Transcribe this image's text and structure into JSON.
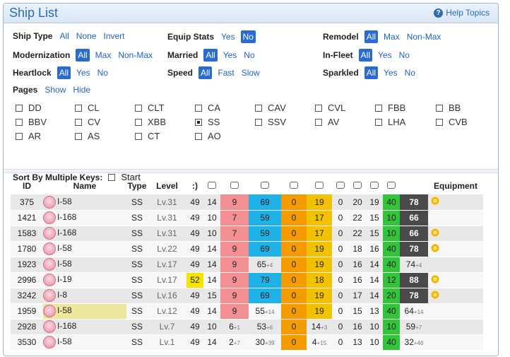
{
  "header": {
    "title": "Ship List",
    "help": "Help Topics"
  },
  "filters": {
    "ship_type": {
      "label": "Ship Type",
      "options": [
        "All",
        "None",
        "Invert"
      ]
    },
    "equip_stats": {
      "label": "Equip Stats",
      "options": [
        "Yes",
        "No"
      ]
    },
    "remodel": {
      "label": "Remodel",
      "options": [
        "All",
        "Max",
        "Non-Max"
      ]
    },
    "modernization": {
      "label": "Modernization",
      "options": [
        "All",
        "Max",
        "Non-Max"
      ]
    },
    "married": {
      "label": "Married",
      "options": [
        "All",
        "Yes",
        "No"
      ]
    },
    "in_fleet": {
      "label": "In-Fleet",
      "options": [
        "All",
        "Yes",
        "No"
      ]
    },
    "heartlock": {
      "label": "Heartlock",
      "options": [
        "All",
        "Yes",
        "No"
      ]
    },
    "speed": {
      "label": "Speed",
      "options": [
        "All",
        "Fast",
        "Slow"
      ]
    },
    "sparkled": {
      "label": "Sparkled",
      "options": [
        "All",
        "Yes",
        "No"
      ]
    },
    "pages": {
      "label": "Pages",
      "options": [
        "Show",
        "Hide"
      ]
    }
  },
  "types": [
    "DD",
    "CL",
    "CLT",
    "CA",
    "CAV",
    "CVL",
    "FBB",
    "BB",
    "BBV",
    "CV",
    "XBB",
    "SS",
    "SSV",
    "AV",
    "LHA",
    "CVB",
    "AR",
    "AS",
    "CT",
    "AO"
  ],
  "sort": {
    "label": "Sort By Multiple Keys:",
    "start": "Start"
  },
  "table": {
    "headers": [
      "ID",
      "Name",
      "Type",
      "Level",
      ":)",
      "HP",
      "FP",
      "TP",
      "AA",
      "AR",
      "ASW",
      "EV",
      "LOS",
      "Luck",
      "Equipment"
    ],
    "rows": [
      {
        "id": "375",
        "name": "I-58",
        "type": "SS",
        "lv": "Lv.31",
        "mor": "49",
        "hp": "14",
        "fp": "9",
        "tp": "69",
        "aa": "0",
        "ar": "19",
        "asw": "0",
        "ev": "20",
        "los": "19",
        "luck": "40",
        "eq": "78",
        "gear": true
      },
      {
        "id": "1421",
        "name": "I-168",
        "type": "SS",
        "lv": "Lv.31",
        "mor": "49",
        "hp": "10",
        "fp": "7",
        "tp": "59",
        "aa": "0",
        "ar": "17",
        "asw": "0",
        "ev": "22",
        "los": "15",
        "luck": "10",
        "eq": "66",
        "gear": false
      },
      {
        "id": "1583",
        "name": "I-168",
        "type": "SS",
        "lv": "Lv.31",
        "mor": "49",
        "hp": "10",
        "fp": "7",
        "tp": "59",
        "aa": "0",
        "ar": "17",
        "asw": "0",
        "ev": "22",
        "los": "15",
        "luck": "10",
        "eq": "66",
        "gear": true
      },
      {
        "id": "1780",
        "name": "I-58",
        "type": "SS",
        "lv": "Lv.22",
        "mor": "49",
        "hp": "14",
        "fp": "9",
        "tp": "69",
        "aa": "0",
        "ar": "19",
        "asw": "0",
        "ev": "18",
        "los": "16",
        "luck": "40",
        "eq": "78",
        "gear": true
      },
      {
        "id": "1923",
        "name": "I-58",
        "type": "SS",
        "lv": "Lv.17",
        "mor": "49",
        "hp": "14",
        "fp": "9",
        "tp": "65",
        "tp_sub": "+4",
        "aa": "0",
        "ar": "19",
        "asw": "0",
        "ev": "16",
        "los": "14",
        "luck": "40",
        "eq": "74",
        "eq_sub": "+4",
        "gear": false
      },
      {
        "id": "2996",
        "name": "I-19",
        "type": "SS",
        "lv": "Lv.17",
        "mor": "52",
        "hp": "14",
        "fp": "9",
        "tp": "79",
        "aa": "0",
        "ar": "18",
        "asw": "0",
        "ev": "16",
        "los": "14",
        "luck": "12",
        "eq": "88",
        "gear": true
      },
      {
        "id": "3242",
        "name": "I-8",
        "type": "SS",
        "lv": "Lv.16",
        "mor": "49",
        "hp": "15",
        "fp": "9",
        "tp": "69",
        "aa": "0",
        "ar": "19",
        "asw": "0",
        "ev": "17",
        "los": "14",
        "luck": "20",
        "eq": "78",
        "gear": true
      },
      {
        "id": "1959",
        "name": "I-58",
        "type": "SS",
        "lv": "Lv.12",
        "mor": "49",
        "hp": "14",
        "fp": "9",
        "tp": "55",
        "tp_sub": "+14",
        "aa": "0",
        "ar": "19",
        "asw": "0",
        "ev": "15",
        "los": "13",
        "luck": "40",
        "eq": "64",
        "eq_sub": "+14",
        "gear": false
      },
      {
        "id": "2928",
        "name": "I-168",
        "type": "SS",
        "lv": "Lv.7",
        "mor": "49",
        "hp": "10",
        "fp": "6",
        "fp_sub": "+1",
        "tp": "53",
        "tp_sub": "+6",
        "aa": "0",
        "ar": "14",
        "ar_sub": "+3",
        "asw": "0",
        "ev": "16",
        "los": "10",
        "luck": "10",
        "eq": "59",
        "eq_sub": "+7",
        "gear": false
      },
      {
        "id": "3530",
        "name": "I-58",
        "type": "SS",
        "lv": "Lv.1",
        "mor": "49",
        "hp": "14",
        "fp": "2",
        "fp_sub": "+7",
        "tp": "30",
        "tp_sub": "+39",
        "aa": "0",
        "ar": "4",
        "ar_sub": "+15",
        "asw": "0",
        "ev": "13",
        "los": "10",
        "luck": "40",
        "eq": "32",
        "eq_sub": "+46",
        "gear": false
      }
    ]
  }
}
